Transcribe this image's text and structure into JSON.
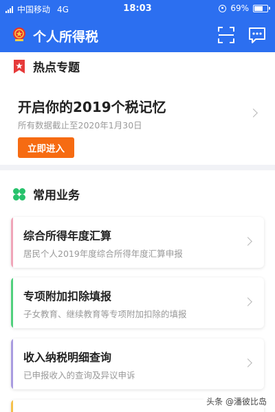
{
  "status_bar": {
    "carrier": "中国移动",
    "network": "4G",
    "time": "18:03",
    "battery_percent": "69%",
    "battery_level": 0.69
  },
  "header": {
    "title": "个人所得税",
    "logo_icon": "national-emblem-icon",
    "scan_icon": "scan-icon",
    "message_icon": "message-icon"
  },
  "hot_topics": {
    "title": "热点专题",
    "icon": "bookmark-star-icon",
    "headline": "开启你的2019个税记忆",
    "subtitle": "所有数据截止至2020年1月30日",
    "button_label": "立即进入"
  },
  "common_services": {
    "title": "常用业务",
    "icon": "clover-icon",
    "items": [
      {
        "title": "综合所得年度汇算",
        "desc": "居民个人2019年度综合所得年度汇算申报",
        "accent": "#f0a5b8"
      },
      {
        "title": "专项附加扣除填报",
        "desc": "子女教育、继续教育等专项附加扣除的填报",
        "accent": "#4fd07c"
      },
      {
        "title": "收入纳税明细查询",
        "desc": "已申报收入的查询及异议申诉",
        "accent": "#a99be0"
      },
      {
        "title": "",
        "desc": "",
        "accent": "#f5c04a"
      }
    ]
  },
  "watermark": "头条 @潘彼比岛",
  "colors": {
    "brand_blue": "#2c6ff0",
    "button_orange": "#f66b12",
    "hot_icon_red": "#e63a3a",
    "common_icon_green": "#27c26c"
  }
}
